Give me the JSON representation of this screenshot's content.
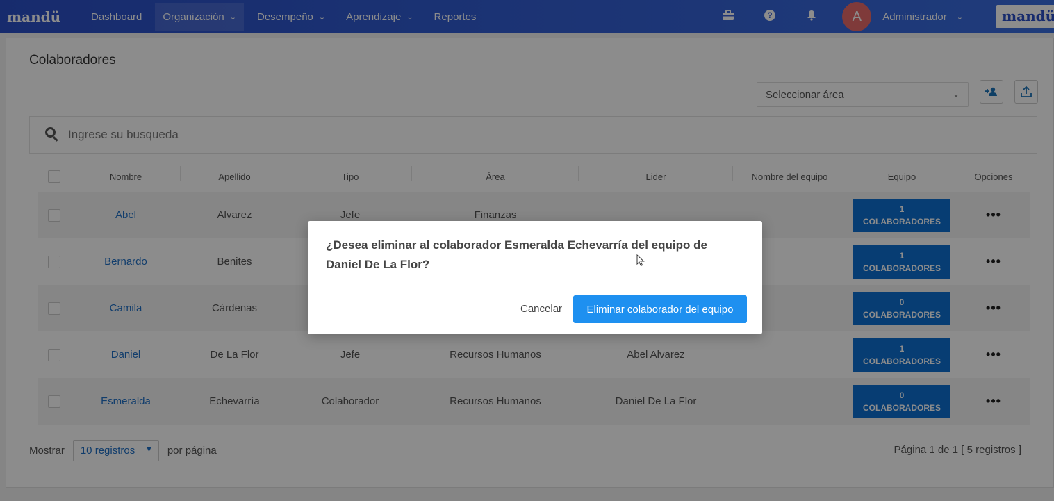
{
  "nav": {
    "brand": "mandü",
    "items": [
      {
        "label": "Dashboard",
        "chevron": false
      },
      {
        "label": "Organización",
        "chevron": true
      },
      {
        "label": "Desempeño",
        "chevron": true
      },
      {
        "label": "Aprendizaje",
        "chevron": true
      },
      {
        "label": "Reportes",
        "chevron": false
      }
    ],
    "icons": [
      "briefcase-icon",
      "help-icon",
      "bell-icon"
    ],
    "avatar_letter": "A",
    "user_label": "Administrador",
    "brand_box": "mandü"
  },
  "page": {
    "title": "Colaboradores",
    "area_select_placeholder": "Seleccionar área",
    "search_placeholder": "Ingrese su busqueda"
  },
  "table": {
    "columns": [
      "Nombre",
      "Apellido",
      "Tipo",
      "Área",
      "Lider",
      "Nombre del equipo",
      "Equipo",
      "Opciones"
    ],
    "team_suffix": "COLABORADORES",
    "rows": [
      {
        "nombre": "Abel",
        "apellido": "Alvarez",
        "tipo": "Jefe",
        "area": "Finanzas",
        "lider": "",
        "equipo_nombre": "",
        "equipo_count": "1"
      },
      {
        "nombre": "Bernardo",
        "apellido": "Benites",
        "tipo": "",
        "area": "",
        "lider": "",
        "equipo_nombre": "",
        "equipo_count": "1"
      },
      {
        "nombre": "Camila",
        "apellido": "Cárdenas",
        "tipo": "",
        "area": "",
        "lider": "",
        "equipo_nombre": "",
        "equipo_count": "0"
      },
      {
        "nombre": "Daniel",
        "apellido": "De La Flor",
        "tipo": "Jefe",
        "area": "Recursos Humanos",
        "lider": "Abel Alvarez",
        "equipo_nombre": "",
        "equipo_count": "1"
      },
      {
        "nombre": "Esmeralda",
        "apellido": "Echevarría",
        "tipo": "Colaborador",
        "area": "Recursos Humanos",
        "lider": "Daniel De La Flor",
        "equipo_nombre": "",
        "equipo_count": "0"
      }
    ]
  },
  "footer": {
    "show_label": "Mostrar",
    "page_size": "10 registros",
    "per_page_label": "por página",
    "pagination_text": "Página 1 de 1 [ 5 registros ]"
  },
  "modal": {
    "message": "¿Desea eliminar al colaborador Esmeralda Echevarría del equipo de Daniel De La Flor?",
    "cancel_label": "Cancelar",
    "confirm_label": "Eliminar colaborador del equipo"
  }
}
